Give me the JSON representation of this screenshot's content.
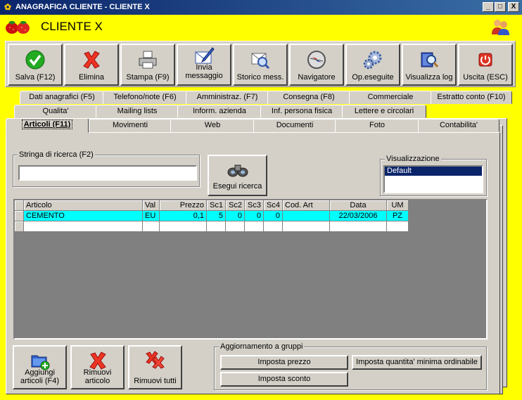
{
  "window": {
    "title": "ANAGRAFICA CLIENTE - CLIENTE X",
    "minimize": "_",
    "maximize": "□",
    "close": "X"
  },
  "header": {
    "client_name": "CLIENTE X"
  },
  "toolbar": {
    "buttons": [
      {
        "label": "Salva (F12)",
        "icon": "check-icon"
      },
      {
        "label": "Elimina",
        "icon": "delete-x-icon"
      },
      {
        "label": "Stampa (F9)",
        "icon": "printer-icon"
      },
      {
        "label": "Invia messaggio",
        "icon": "envelope-pen-icon"
      },
      {
        "label": "Storico mess.",
        "icon": "envelope-magnifier-icon"
      },
      {
        "label": "Navigatore",
        "icon": "compass-icon"
      },
      {
        "label": "Op.eseguite",
        "icon": "gears-icon"
      },
      {
        "label": "Visualizza log",
        "icon": "book-magnifier-icon"
      },
      {
        "label": "Uscita (ESC)",
        "icon": "power-icon"
      }
    ]
  },
  "tabs": {
    "row1": [
      "Dati anagrafici (F5)",
      "Telefono/note (F6)",
      "Amministraz. (F7)",
      "Consegna (F8)",
      "Commerciale",
      "Estratto conto (F10)"
    ],
    "row2": [
      "Qualita'",
      "Mailing lists",
      "Inform. azienda",
      "Inf. persona fisica",
      "Lettere e circolari"
    ],
    "row3": [
      "Articoli (F11)",
      "Movimenti",
      "Web",
      "Documenti",
      "Foto",
      "Contabilita'"
    ]
  },
  "search": {
    "label": "Stringa di ricerca (F2)",
    "value": "",
    "button": "Esegui ricerca"
  },
  "view": {
    "label": "Visualizzazione",
    "selected": "Default"
  },
  "grid": {
    "columns": [
      "Articolo",
      "Val",
      "Prezzo",
      "Sc1",
      "Sc2",
      "Sc3",
      "Sc4",
      "Cod. Art",
      "Data",
      "UM"
    ],
    "rows": [
      [
        "CEMENTO",
        "EU",
        "0,1",
        "5",
        "0",
        "0",
        "0",
        "",
        "22/03/2006",
        "PZ"
      ]
    ]
  },
  "bottom": {
    "add_label": "Aggiungi articoli (F4)",
    "remove_label": "Rimuovi articolo",
    "remove_all_label": "Rimuovi tutti",
    "group_title": "Aggiornamento a gruppi",
    "set_price": "Imposta prezzo",
    "set_min_qty": "Imposta quantita' minima ordinabile",
    "set_discount": "Imposta sconto"
  }
}
